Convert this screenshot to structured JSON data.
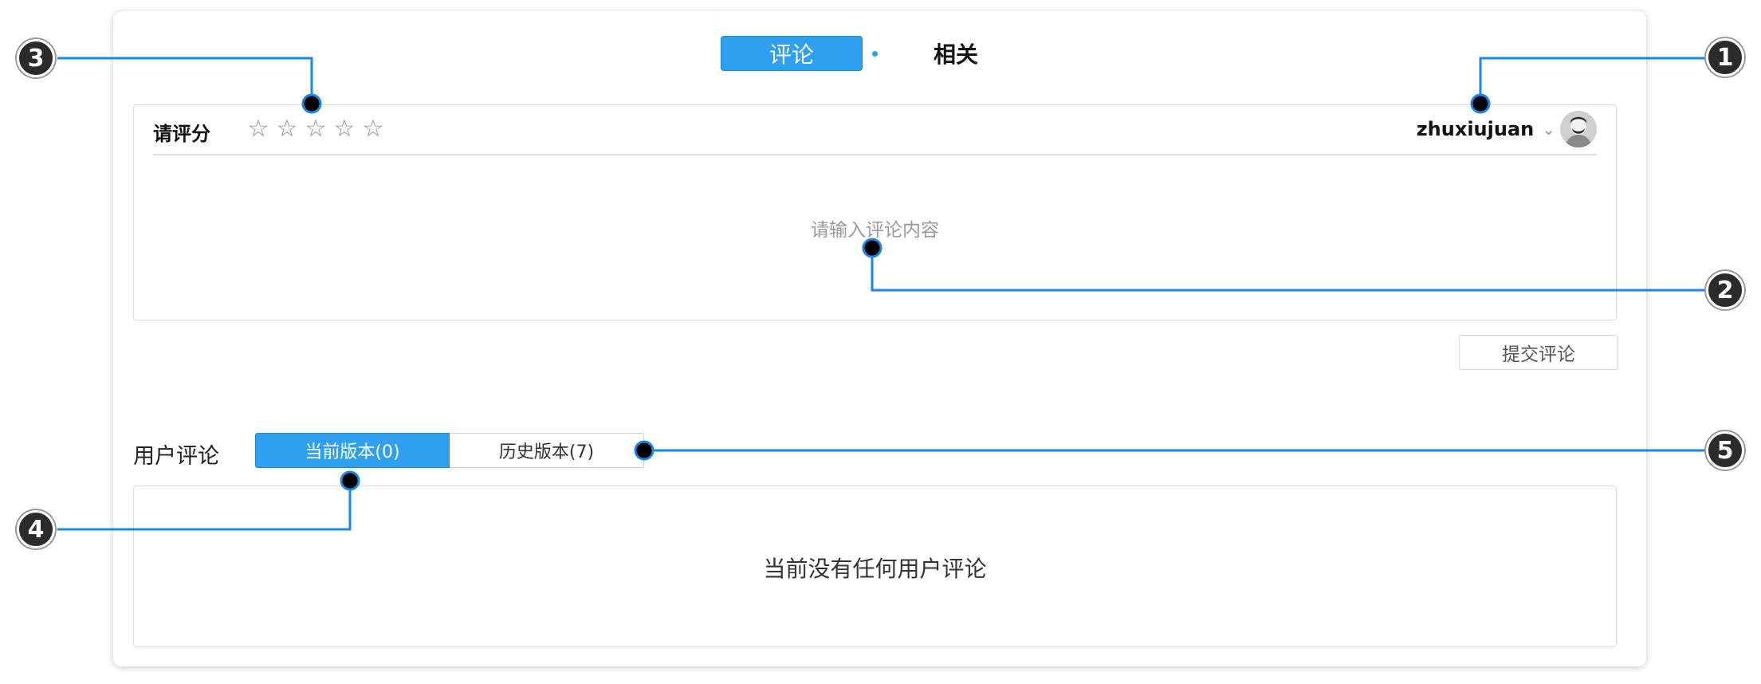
{
  "tabs": {
    "active": "评论",
    "other": "相关"
  },
  "rating": {
    "label": "请评分",
    "stars": [
      "☆",
      "☆",
      "☆",
      "☆",
      "☆"
    ],
    "value": 0,
    "max": 5
  },
  "user": {
    "name": "zhuxiujuan",
    "dropdown_icon": "chevron-down-icon",
    "avatar_icon": "avatar"
  },
  "editor": {
    "placeholder": "请输入评论内容"
  },
  "submit": {
    "label": "提交评论"
  },
  "user_comments": {
    "title": "用户评论",
    "current_tab": "当前版本(0)",
    "history_tab": "历史版本(7)",
    "empty_text": "当前没有任何用户评论"
  },
  "callouts": [
    "1",
    "2",
    "3",
    "4",
    "5"
  ],
  "colors": {
    "accent": "#2f9ff0",
    "callout_line": "#1a86e8",
    "badge": "#2b2b2b"
  }
}
